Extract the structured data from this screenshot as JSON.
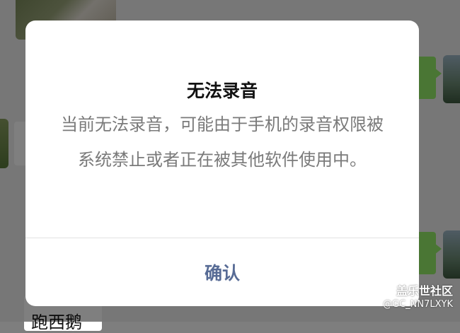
{
  "dialog": {
    "title": "无法录音",
    "message": "当前无法录音，可能由于手机的录音权限被系统禁止或者正在被其他软件使用中。",
    "confirm_label": "确认"
  },
  "background": {
    "chat_snippet": "跑西鹅"
  },
  "watermark": {
    "brand": "盖乐世社区",
    "user": "@GC_NN7LXYK"
  },
  "colors": {
    "confirm_text": "#576b95",
    "sent_bubble": "#95ec69",
    "message_text": "#7a7a7a"
  }
}
